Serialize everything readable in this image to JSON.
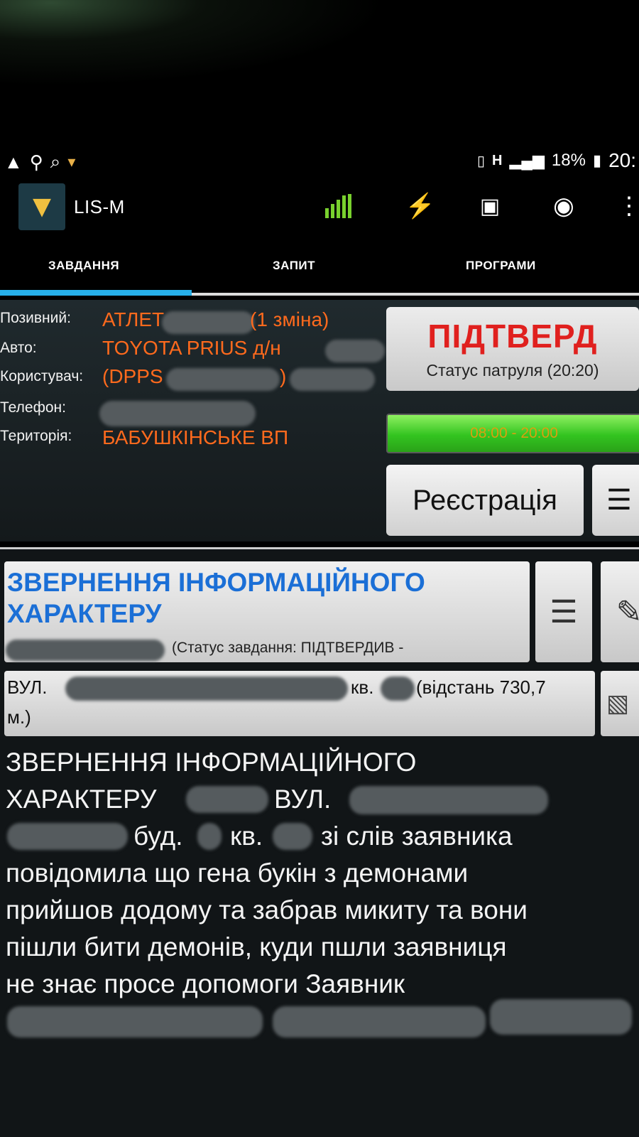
{
  "app": {
    "title": "LIS-M"
  },
  "status_bar": {
    "battery": "18%",
    "time": "20:"
  },
  "tabs": [
    {
      "label": "ЗАВДАННЯ",
      "active": true
    },
    {
      "label": "ЗАПИТ",
      "active": false
    },
    {
      "label": "ПРОГРАМИ",
      "active": false
    }
  ],
  "patrol": {
    "callsign_label": "Позивний:",
    "callsign_prefix": "АТЛЕТ-",
    "callsign_shift": "(1 зміна)",
    "car_label": "Авто:",
    "car_value": "TOYOTA PRIUS д/н",
    "user_label": "Користувач:",
    "user_value": "(DPPS",
    "user_suffix": ")",
    "phone_label": "Телефон:",
    "territory_label": "Територія:",
    "territory_value": "БАБУШКІНСЬКЕ ВП"
  },
  "status_button": {
    "label": "ПІДТВЕРД",
    "sub": "Статус патруля (20:20)"
  },
  "shift_time": "08:00 - 20:00",
  "registration_button": "Реєстрація",
  "task": {
    "title": "ЗВЕРНЕННЯ ІНФОРМАЦІЙНОГО ХАРАКТЕРУ",
    "status": "(Статус завдання: ПІДТВЕРДИВ -",
    "address_prefix": "ВУЛ.",
    "address_apt": "кв.",
    "distance": "(відстань 730,7",
    "distance_unit": "м.)",
    "description_lines": [
      "ЗВЕРНЕННЯ ІНФОРМАЦІЙНОГО",
      "ХАРАКТЕРУ",
      "буд.",
      "повідомила що гена букін з демонами",
      "прийшов додому та забрав микиту та вони",
      "пішли бити демонів, куди пшли заявниця",
      "не знає просе допомоги Заявник"
    ],
    "description_street": "ВУЛ.",
    "description_apt": "кв.",
    "description_tail": "зі слів заявника"
  },
  "icons": {
    "status_bar_left": [
      "navigation-icon",
      "location-pin-icon",
      "search-icon",
      "fox-icon"
    ],
    "status_bar_right": [
      "vibrate-icon",
      "network-h-icon",
      "signal-icon",
      "battery-icon"
    ],
    "action_bar": [
      "signal-strength-icon",
      "lightning-icon",
      "map-icon",
      "eye-icon",
      "overflow-menu-icon"
    ]
  },
  "colors": {
    "accent": "#27b0ea",
    "field_value": "#ff6a1d",
    "status_red": "#e0201e",
    "task_title": "#1b6fd6",
    "shift_green": "#33c420"
  }
}
